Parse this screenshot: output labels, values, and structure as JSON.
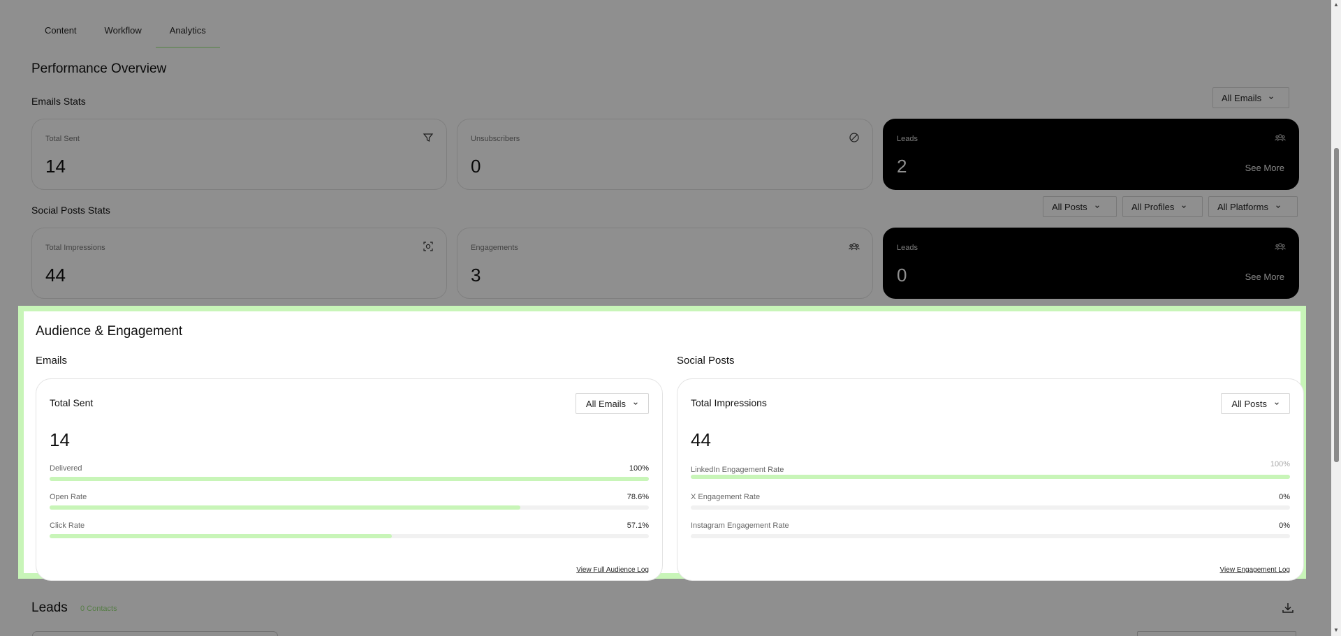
{
  "tabs": [
    {
      "label": "Content"
    },
    {
      "label": "Workflow"
    },
    {
      "label": "Analytics",
      "active": true
    }
  ],
  "performance": {
    "title": "Performance Overview",
    "emails_stats": {
      "title": "Emails Stats",
      "filter": "All Emails",
      "cards": [
        {
          "label": "Total Sent",
          "value": "14",
          "icon": "filter-icon"
        },
        {
          "label": "Unsubscribers",
          "value": "0",
          "icon": "block-icon"
        },
        {
          "label": "Leads",
          "value": "2",
          "icon": "people-icon",
          "see_more": "See More"
        }
      ]
    },
    "social_stats": {
      "title": "Social Posts Stats",
      "filters": [
        "All Posts",
        "All Profiles",
        "All Platforms"
      ],
      "cards": [
        {
          "label": "Total Impressions",
          "value": "44",
          "icon": "scan-icon"
        },
        {
          "label": "Engagements",
          "value": "3",
          "icon": "people-icon"
        },
        {
          "label": "Leads",
          "value": "0",
          "icon": "people-icon",
          "see_more": "See More"
        }
      ]
    }
  },
  "audience": {
    "title": "Audience & Engagement",
    "emails": {
      "section": "Emails",
      "card_title": "Total Sent",
      "filter": "All Emails",
      "value": "14",
      "metrics": [
        {
          "label": "Delivered",
          "pct": "100%",
          "fraction": 1.0
        },
        {
          "label": "Open Rate",
          "pct": "78.6%",
          "fraction": 0.786
        },
        {
          "label": "Click Rate",
          "pct": "57.1%",
          "fraction": 0.571
        }
      ],
      "link": "View Full Audience Log"
    },
    "social": {
      "section": "Social Posts",
      "card_title": "Total Impressions",
      "filter": "All Posts",
      "value": "44",
      "metrics": [
        {
          "label": "LinkedIn Engagement Rate",
          "pct": "100%",
          "fraction": 1.0
        },
        {
          "label": "X Engagement Rate",
          "pct": "0%",
          "fraction": 0
        },
        {
          "label": "Instagram Engagement Rate",
          "pct": "0%",
          "fraction": 0
        }
      ],
      "link": "View Engagement Log"
    }
  },
  "leads": {
    "title": "Leads",
    "count": "0 Contacts"
  },
  "colors": {
    "accent": "#c8f5b8",
    "dark_card": "#000000"
  }
}
